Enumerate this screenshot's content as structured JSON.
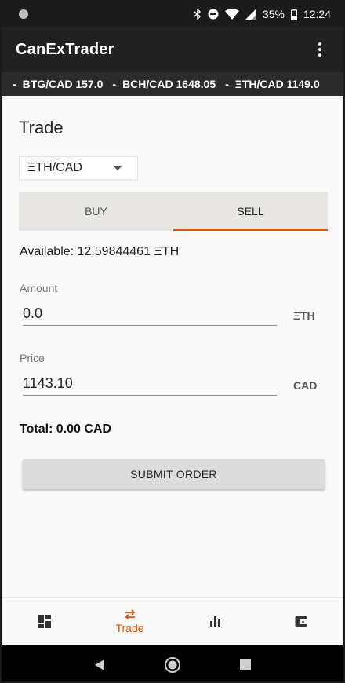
{
  "status_bar": {
    "battery": "35%",
    "time": "12:24"
  },
  "app_bar": {
    "title": "CanExTrader"
  },
  "ticker": [
    {
      "pair": "BTG/CAD",
      "price": "157.0"
    },
    {
      "pair": "BCH/CAD",
      "price": "1648.05"
    },
    {
      "pair": "ΞTH/CAD",
      "price": "1149.0"
    }
  ],
  "trade": {
    "title": "Trade",
    "pair": "ΞTH/CAD",
    "tabs": [
      {
        "label": "BUY",
        "active": false
      },
      {
        "label": "SELL",
        "active": true
      }
    ],
    "available": "Available: 12.59844461 ΞTH",
    "amount_label": "Amount",
    "amount_value": "0.0",
    "amount_unit": "ΞTH",
    "price_label": "Price",
    "price_value": "1143.10",
    "price_unit": "CAD",
    "total": "Total: 0.00 CAD",
    "submit_label": "SUBMIT ORDER"
  },
  "bottom_nav": {
    "trade_label": "Trade",
    "active_color": "#e65100"
  }
}
